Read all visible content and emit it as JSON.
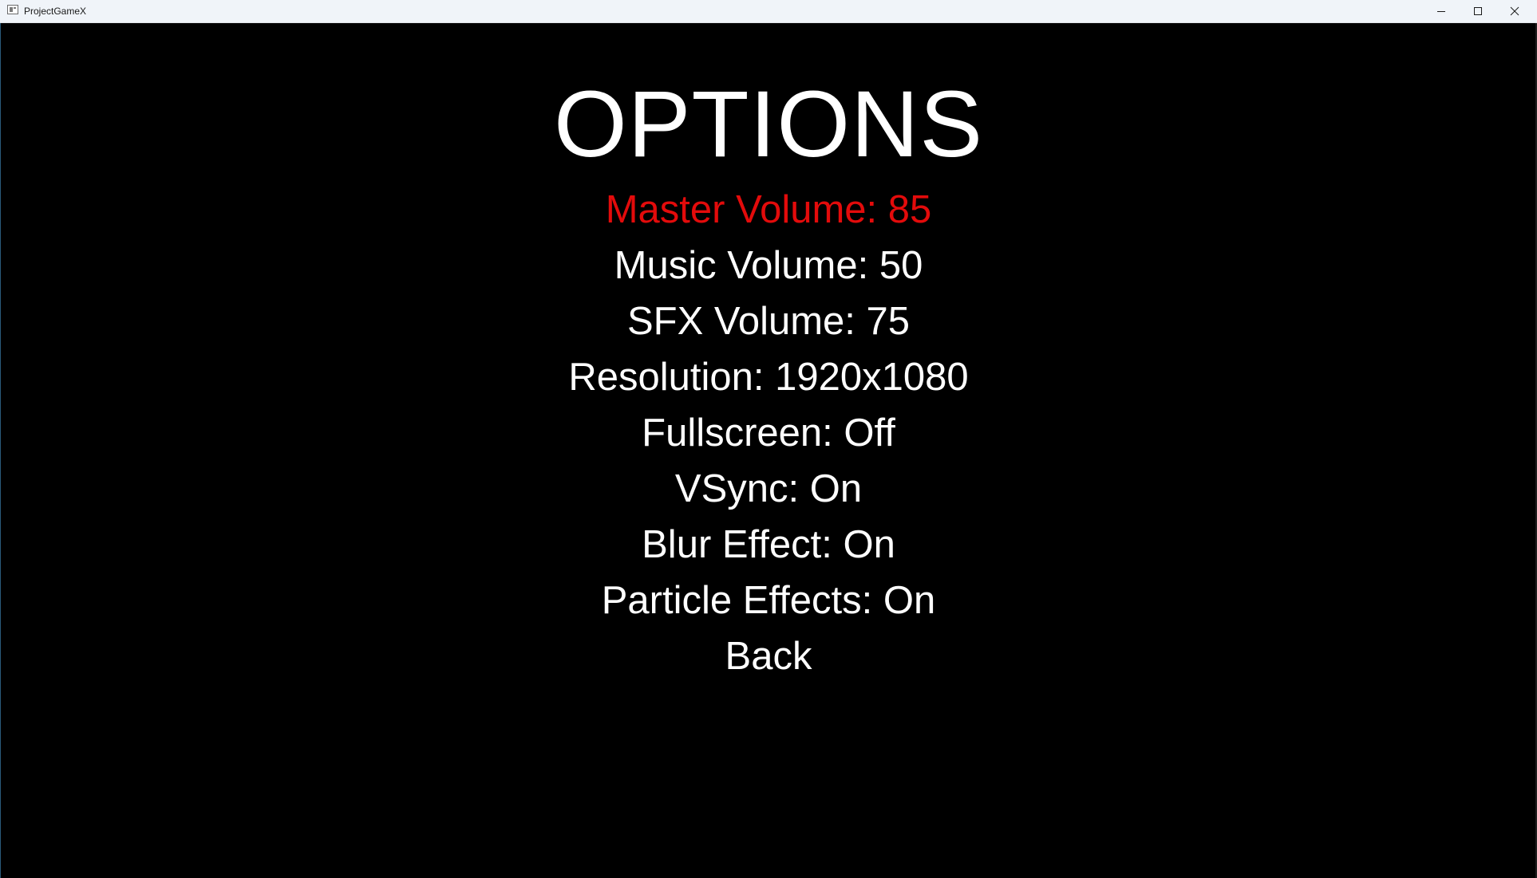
{
  "window": {
    "title": "ProjectGameX"
  },
  "menu": {
    "heading": "OPTIONS",
    "selected_color": "#e30b0b",
    "items": [
      {
        "label": "Master Volume: 85",
        "selected": true
      },
      {
        "label": "Music Volume: 50",
        "selected": false
      },
      {
        "label": "SFX Volume: 75",
        "selected": false
      },
      {
        "label": "Resolution: 1920x1080",
        "selected": false
      },
      {
        "label": "Fullscreen: Off",
        "selected": false
      },
      {
        "label": "VSync: On",
        "selected": false
      },
      {
        "label": "Blur Effect: On",
        "selected": false
      },
      {
        "label": "Particle Effects: On",
        "selected": false
      },
      {
        "label": "Back",
        "selected": false
      }
    ]
  },
  "icons": {
    "app": "app-window-icon",
    "minimize": "minimize-icon",
    "maximize": "maximize-icon",
    "close": "close-icon"
  }
}
